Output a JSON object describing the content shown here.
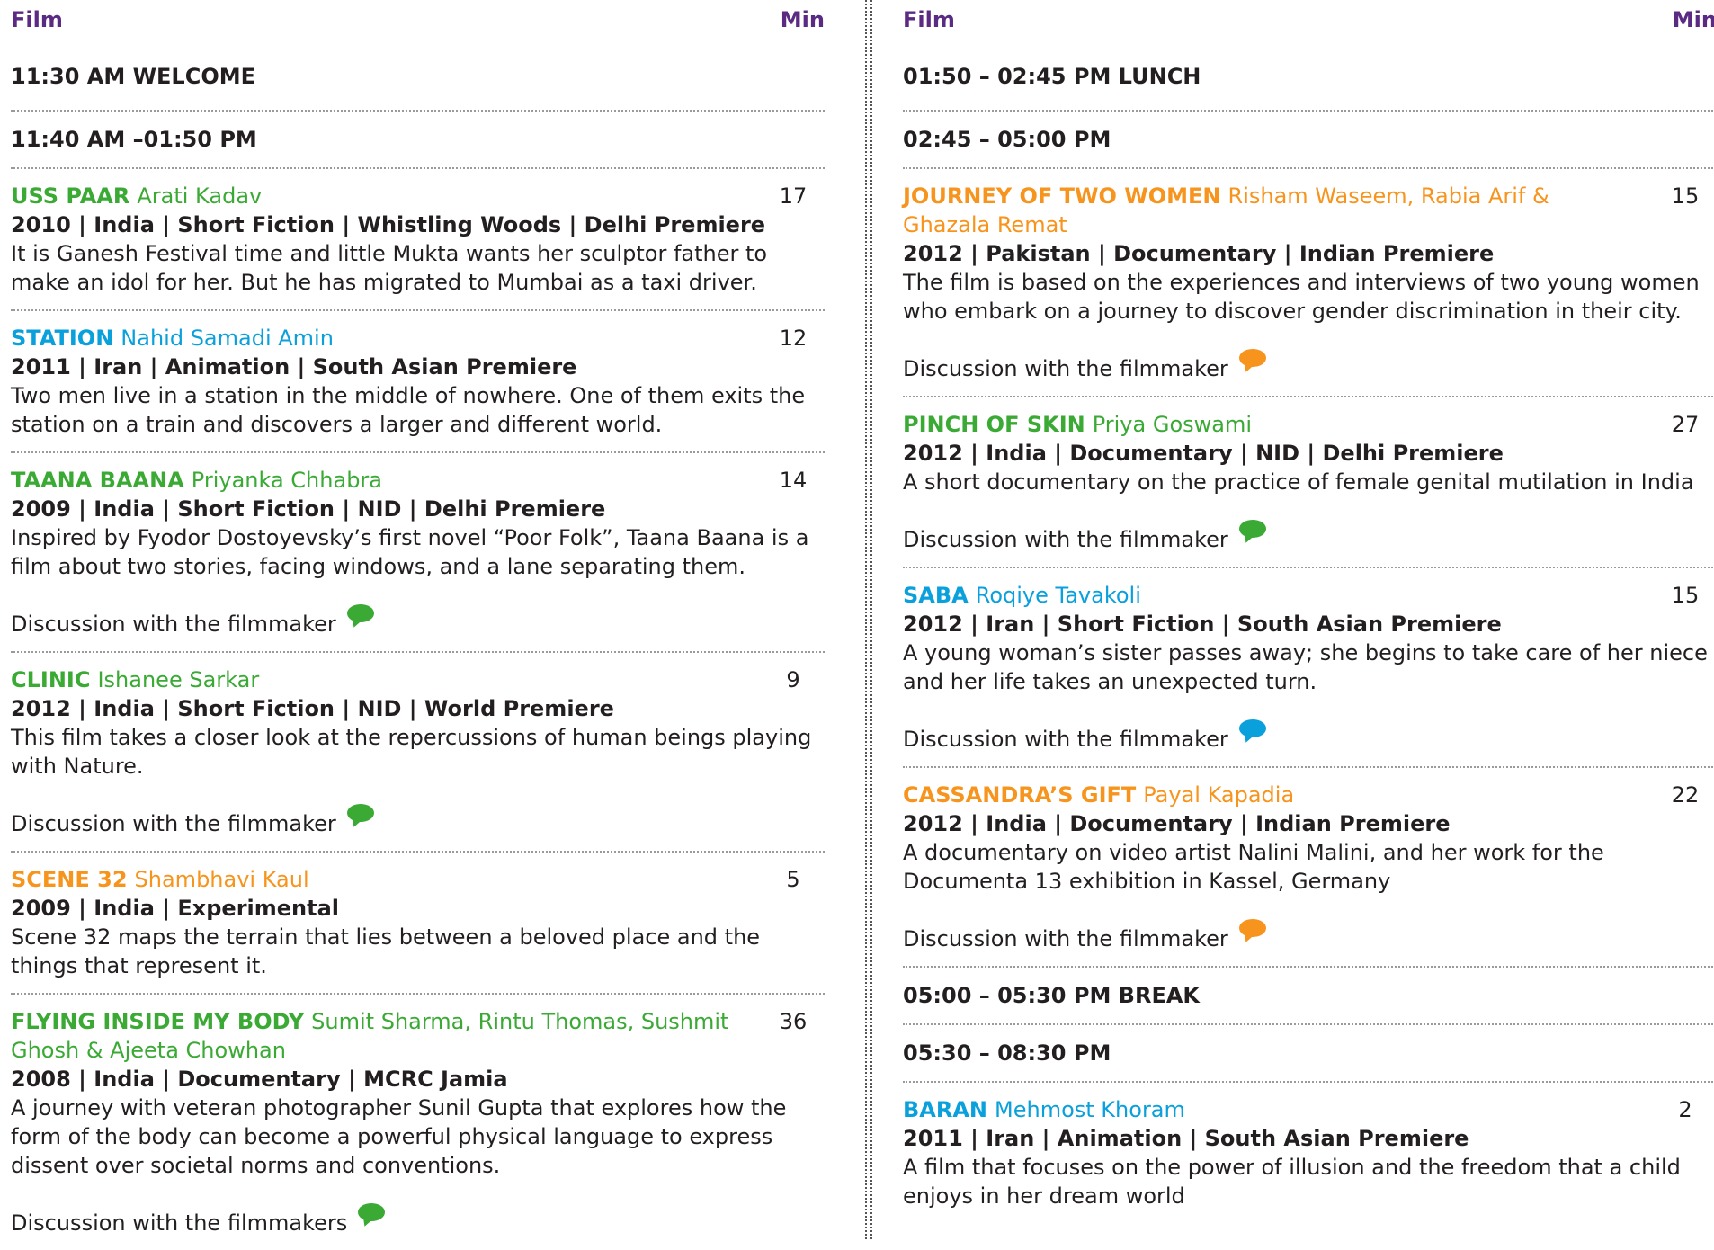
{
  "colors": {
    "green": "#3aaa35",
    "orange": "#f7941d",
    "blue": "#0aa0dc",
    "header": "#5b2a82"
  },
  "left": {
    "header_film": "Film",
    "header_min": "Min",
    "slots": [
      "11:30 AM WELCOME",
      "11:40 AM –01:50 PM"
    ],
    "films": [
      {
        "title": "USS PAAR",
        "director": "Arati Kadav",
        "min": "17",
        "color": "green",
        "meta": "2010 | India | Short Fiction | Whistling Woods | Delhi Premiere",
        "desc": "It is Ganesh Festival time and little Mukta wants her sculptor father to make an idol for her. But he has migrated to Mumbai as a taxi driver.",
        "discussion": ""
      },
      {
        "title": "STATION",
        "director": "Nahid Samadi Amin",
        "min": "12",
        "color": "blue",
        "meta": "2011 | Iran | Animation | South Asian Premiere",
        "desc": "Two men live in a station in the middle of nowhere. One of them exits the station on a train and discovers a larger and different world.",
        "discussion": ""
      },
      {
        "title": "TAANA BAANA",
        "director": "Priyanka Chhabra",
        "min": "14",
        "color": "green",
        "meta": "2009 | India | Short Fiction | NID | Delhi Premiere",
        "desc": "Inspired by Fyodor Dostoyevsky’s first novel “Poor Folk”, Taana Baana is a film about two stories, facing windows, and a lane separating them.",
        "discussion": "Discussion with the filmmaker",
        "bubble": "green"
      },
      {
        "title": "CLINIC",
        "director": "Ishanee Sarkar",
        "min": "9",
        "color": "green",
        "meta": "2012 | India | Short Fiction | NID | World Premiere",
        "desc": "This film takes a closer look at the repercussions of human beings playing with Nature.",
        "discussion": "Discussion with the filmmaker",
        "bubble": "green"
      },
      {
        "title": "SCENE 32",
        "director": "Shambhavi Kaul",
        "min": "5",
        "color": "orange",
        "meta": "2009 | India | Experimental",
        "desc": "Scene 32 maps the terrain that lies between a beloved place and the things that represent it.",
        "discussion": ""
      },
      {
        "title": "FLYING INSIDE MY BODY",
        "director": "Sumit Sharma, Rintu Thomas, Sushmit Ghosh & Ajeeta Chowhan",
        "min": "36",
        "color": "green",
        "meta": "2008 | India | Documentary | MCRC Jamia",
        "desc": "A journey with veteran photographer Sunil Gupta that explores how the form of the body can become a powerful physical language to express dissent over societal norms and conventions.",
        "discussion": "Discussion with the filmmakers",
        "bubble": "green"
      }
    ]
  },
  "right": {
    "header_film": "Film",
    "header_min": "Min",
    "slots": [
      "01:50 – 02:45 PM LUNCH",
      "02:45 – 05:00 PM",
      "05:00 – 05:30 PM BREAK",
      "05:30 – 08:30 PM"
    ],
    "films_a": [
      {
        "title": "JOURNEY OF TWO WOMEN",
        "director": "Risham Waseem, Rabia Arif & Ghazala Remat",
        "min": "15",
        "color": "orange",
        "meta": "2012 | Pakistan | Documentary | Indian Premiere",
        "desc": "The film is based on the experiences and interviews of two young women who embark on a journey to discover gender discrimination in their city.",
        "discussion": "Discussion with the filmmaker",
        "bubble": "orange"
      },
      {
        "title": "PINCH OF SKIN",
        "director": "Priya Goswami",
        "min": "27",
        "color": "green",
        "meta": "2012 | India | Documentary | NID | Delhi Premiere",
        "desc": "A short documentary on the practice of female genital mutilation in India",
        "discussion": "Discussion with the filmmaker",
        "bubble": "green"
      },
      {
        "title": "SABA",
        "director": "Roqiye Tavakoli",
        "min": "15",
        "color": "blue",
        "meta": "2012 | Iran | Short Fiction | South Asian Premiere",
        "desc": "A young woman’s sister passes away; she begins to take care of her niece and her life takes an unexpected turn.",
        "discussion": "Discussion with the filmmaker",
        "bubble": "blue"
      },
      {
        "title": "CASSANDRA’S GIFT",
        "director": "Payal Kapadia",
        "min": "22",
        "color": "orange",
        "meta": "2012 | India | Documentary | Indian Premiere",
        "desc": "A documentary on video artist Nalini Malini, and her work for the Documenta 13 exhibition in Kassel, Germany",
        "discussion": "Discussion with the filmmaker",
        "bubble": "orange"
      }
    ],
    "films_b": [
      {
        "title": "BARAN",
        "director": "Mehmost Khoram",
        "min": "2",
        "color": "blue",
        "meta": "2011 | Iran | Animation | South Asian Premiere",
        "desc": "A film that focuses on the power of illusion and the freedom that a child enjoys in her dream world",
        "discussion": ""
      }
    ]
  }
}
